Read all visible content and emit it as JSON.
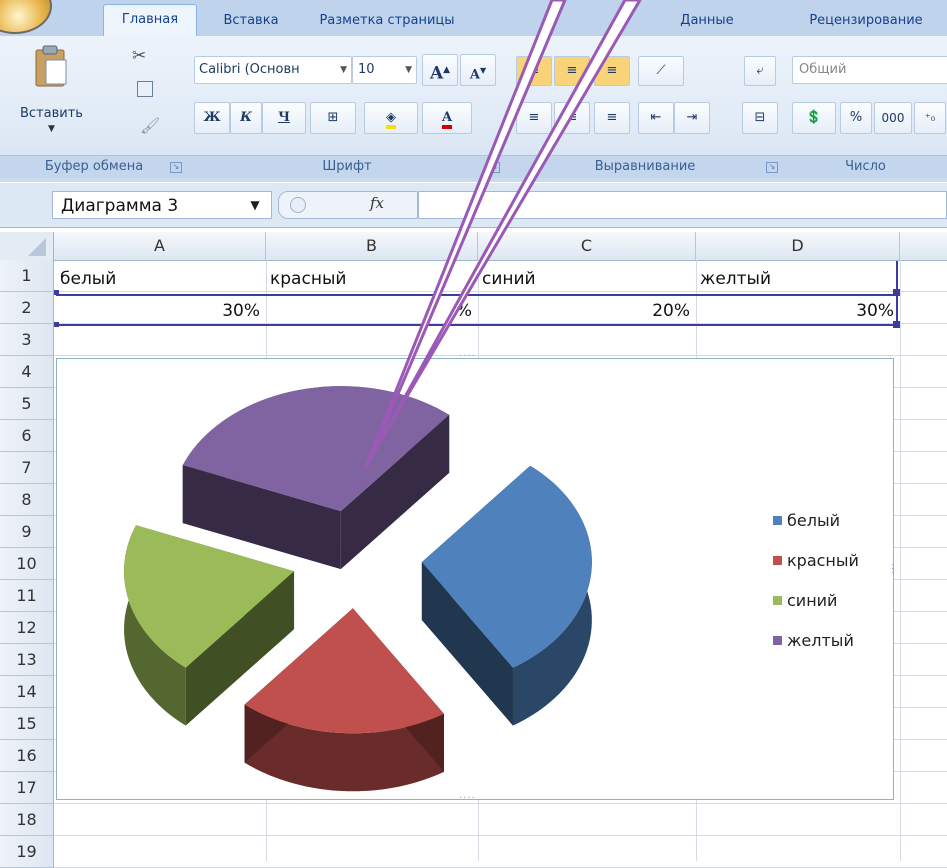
{
  "ribbon": {
    "tabs": [
      {
        "label": "Главная",
        "active": true
      },
      {
        "label": "Вставка",
        "active": false
      },
      {
        "label": "Разметка страницы",
        "active": false
      },
      {
        "label": "Данные",
        "active": false
      },
      {
        "label": "Рецензирование",
        "active": false
      }
    ],
    "clipboard": {
      "paste_label": "Вставить",
      "group_label": "Буфер обмена"
    },
    "font": {
      "font_name": "Calibri (Основн",
      "font_size": "10",
      "group_label": "Шрифт"
    },
    "alignment": {
      "group_label": "Выравнивание"
    },
    "number": {
      "format": "Общий",
      "percent": "%",
      "thousands": "000",
      "group_label": "Число"
    }
  },
  "formula_bar": {
    "name_box": "Диаграмма 3",
    "fx": "fx",
    "formula": ""
  },
  "grid": {
    "columns": [
      "A",
      "B",
      "C",
      "D"
    ],
    "rows": [
      "1",
      "2",
      "3",
      "4",
      "5",
      "6",
      "7",
      "8",
      "9",
      "10",
      "11",
      "12",
      "13",
      "14",
      "15",
      "16",
      "17",
      "18",
      "19"
    ],
    "row1": [
      "белый",
      "красный",
      "синий",
      "желтый"
    ],
    "row2": [
      "30%",
      "%",
      "20%",
      "30%"
    ]
  },
  "chart_data": {
    "type": "pie",
    "variant": "exploded 3D pie",
    "categories": [
      "белый",
      "красный",
      "синий",
      "желтый"
    ],
    "values": [
      30,
      20,
      20,
      30
    ],
    "unit": "%",
    "legend_position": "right",
    "colors": {
      "белый": "#4f81bd",
      "красный": "#c0504d",
      "синий": "#9bbb59",
      "желтый": "#8064a2"
    }
  },
  "colors": {
    "ribbon_text": "#15428b",
    "selection": "#3c3c9c",
    "callout": "#9b59b6"
  }
}
